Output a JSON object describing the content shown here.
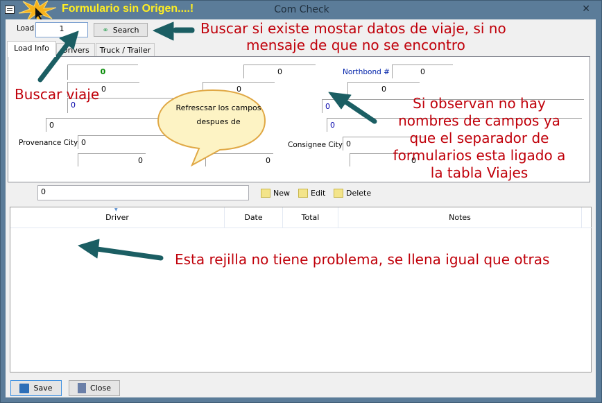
{
  "window": {
    "title": "Com Check",
    "banner": "Formulario sin Origen....!"
  },
  "load": {
    "label": "Load",
    "value": "1",
    "search_label": "Search"
  },
  "tabs": [
    {
      "label": "Load Info"
    },
    {
      "label": "Drivers"
    },
    {
      "label": "Truck / Trailer"
    }
  ],
  "fields": {
    "f1": "0",
    "f2": "0",
    "f3": "0",
    "f4": "0",
    "provenance_label": "Provenance City",
    "provenance": "0",
    "f6": "0",
    "m1": "0",
    "m2": "0",
    "m3": "0",
    "northbond_label": "Northbond #",
    "northbond": "0",
    "r2": "0",
    "r3": "0",
    "r4": "0",
    "consignee_label": "Consignee City",
    "consignee": "0",
    "r6": "0"
  },
  "toolbar": {
    "filter_value": "0",
    "new_label": "New",
    "edit_label": "Edit",
    "delete_label": "Delete"
  },
  "grid": {
    "columns": [
      "Driver",
      "Date",
      "Total",
      "Notes"
    ]
  },
  "footer": {
    "save_label": "Save",
    "close_label": "Close"
  },
  "annotations": {
    "search": "Buscar si existe mostar datos de viaje, si no",
    "search2": "mensaje de que no se encontro",
    "buscar": "Buscar viaje",
    "bubble": "Refrescsar los campos despues de",
    "fields1": "Si observan no hay",
    "fields2": "nombres de campos ya",
    "fields3": "que el separador de",
    "fields4": "formularios esta ligado a",
    "fields5": "la tabla Viajes",
    "grid": "Esta rejilla no tiene problema, se llena igual que otras"
  },
  "colors": {
    "frame": "#5b7c99",
    "annotation": "#c0000a",
    "arrow": "#1b5e63",
    "banner": "#ffee22"
  }
}
